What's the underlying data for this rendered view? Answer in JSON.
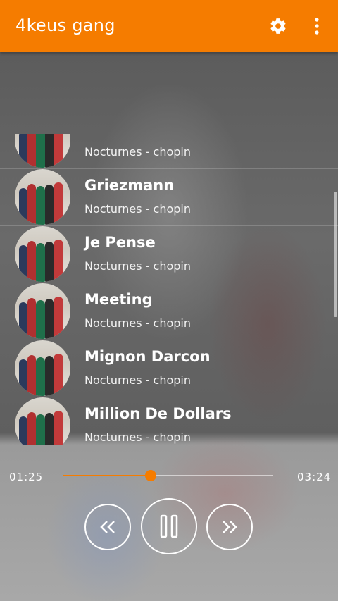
{
  "app": {
    "title": "4keus gang"
  },
  "toolbar": {
    "settings_icon": "gear-icon",
    "overflow_icon": "more-vert-icon"
  },
  "songs": [
    {
      "title": "",
      "subtitle": "Nocturnes - chopin"
    },
    {
      "title": "Griezmann",
      "subtitle": "Nocturnes - chopin"
    },
    {
      "title": "Je Pense",
      "subtitle": "Nocturnes - chopin"
    },
    {
      "title": "Meeting",
      "subtitle": "Nocturnes - chopin"
    },
    {
      "title": "Mignon Darcon",
      "subtitle": "Nocturnes - chopin"
    },
    {
      "title": "Million De Dollars",
      "subtitle": "Nocturnes - chopin"
    }
  ],
  "player": {
    "elapsed": "01:25",
    "duration": "03:24",
    "progress": 0.4167,
    "accent_color": "#f57c00",
    "controls": [
      "rewind-icon",
      "pause-icon",
      "fast-forward-icon"
    ]
  }
}
